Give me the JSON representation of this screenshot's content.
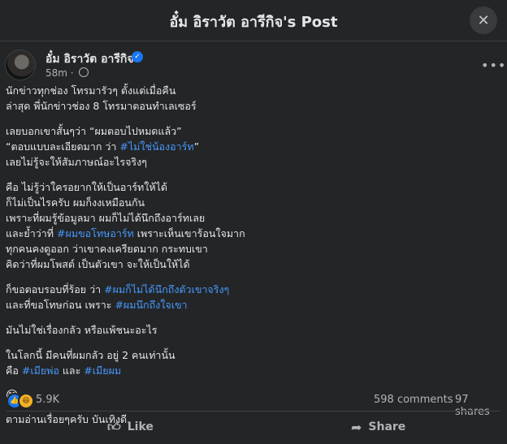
{
  "header": {
    "title": "อั๋ม อิราวัต อารีกิจ's Post"
  },
  "post": {
    "author": "อั๋ม อิราวัต อารีกิจ",
    "time": "58m",
    "separator": "·",
    "paragraphs": [
      [
        "นักข่าวทุกช่อง โทรมารัวๆ ตั้งแต่เมื่อคืน",
        "ล่าสุด พี่นักข่าวช่อง 8 โทรมาตอนทำเลเซอร์"
      ],
      [
        "เลยบอกเขาสั้นๆว่า “ผมตอบไปหมดแล้ว”"
      ]
    ],
    "p2_line2_a": "“ตอบแบบละเอียดมาก ว่า ",
    "p2_line2_tag": "#ไม่ใช่น้องอาร์ท",
    "p2_line2_b": "”",
    "p2_line3": "เลยไม่รู้จะให้สัมภาษณ์อะไรจริงๆ",
    "p3_line1": "คือ ไม่รู้ว่าใครอยากให้เป็นอาร์ทให้ได้",
    "p3_line2": "ก็ไม่เป็นไรครับ ผมก็งงเหมือนกัน",
    "p3_line3": "เพราะที่ผมรู้ข้อมูลมา ผมก็ไม่ได้นึกถึงอาร์ทเลย",
    "p3_line4_a": "และย้ำว่าที่ ",
    "p3_line4_tag": "#ผมขอโทษอาร์ท",
    "p3_line4_b": " เพราะเห็นเขาร้อนใจมาก",
    "p3_line5": "ทุกคนคงดูออก ว่าเขาคงเครียดมาก กระทบเขา",
    "p3_line6": "คิดว่าที่ผมโพสต์ เป็นตัวเขา จะให้เป็นให้ได้",
    "p4_line1_a": "ก็ขอตอบรอบที่ร้อย ว่า ",
    "p4_line1_tag": "#ผมก็ไม่ได้นึกถึงตัวเขาจริงๆ",
    "p4_line2_a": "และที่ขอโทษก่อน เพราะ ",
    "p4_line2_tag": "#ผมนึกถึงใจเขา",
    "p5_line1": "มันไม่ใช่เรื่องกลัว หรือแพ้ชนะอะไร",
    "p6_line1": "ในโลกนี้ มีคนที่ผมกลัว อยู่ 2 คนเท่านั้น",
    "p6_line2_a": "คือ ",
    "p6_line2_tag1": "#เมียพ่อ",
    "p6_line2_mid": " และ ",
    "p6_line2_tag2": "#เมียผม",
    "emoji": "😅",
    "closing": "ตามอ่านเรื่อยๆครับ บันเทิงดี."
  },
  "stats": {
    "reactions": "5.9K",
    "comments": "598 comments",
    "shares": "97 shares"
  },
  "actions": {
    "like": "Like",
    "share": "Share"
  },
  "icons": {
    "close": "close-icon",
    "more": "more-icon",
    "globe": "globe-icon",
    "verified": "verified-badge-icon",
    "like": "thumbs-up-icon",
    "share": "share-arrow-icon"
  },
  "colors": {
    "background": "#242526",
    "hashtag": "#4599ff",
    "accent": "#1877f2"
  }
}
